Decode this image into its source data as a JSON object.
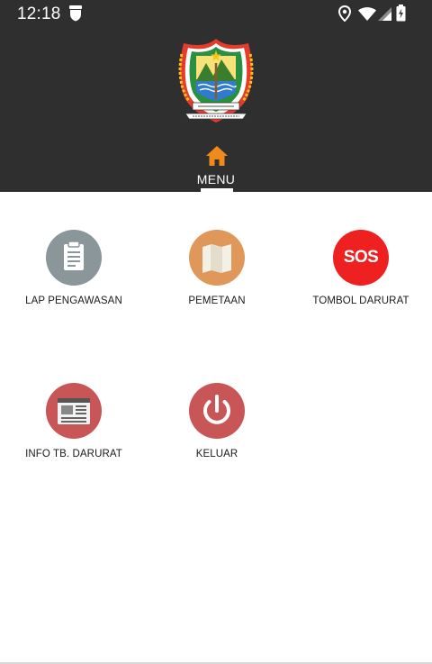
{
  "status_bar": {
    "time": "12:18",
    "icons": [
      "notification-shield-icon",
      "location-icon",
      "wifi-icon",
      "signal-icon",
      "battery-icon"
    ]
  },
  "header": {
    "logo_icon": "jawa-tengah-emblem-icon",
    "tab_icon": "home-icon",
    "tab_label": "MENU",
    "background_color": "#2f2f2f",
    "accent_color": "#f08a1c"
  },
  "menu": {
    "items": [
      {
        "label": "LAP PENGAWASAN",
        "icon": "clipboard-icon",
        "color": "#8a9699"
      },
      {
        "label": "PEMETAAN",
        "icon": "map-icon",
        "color": "#e0975a"
      },
      {
        "label": "TOMBOL DARURAT",
        "icon": "sos-icon",
        "color": "#ee2020",
        "icon_text": "SOS"
      },
      {
        "label": "INFO TB. DARURAT",
        "icon": "newspaper-icon",
        "color": "#c95656"
      },
      {
        "label": "KELUAR",
        "icon": "power-icon",
        "color": "#c95656"
      }
    ]
  }
}
